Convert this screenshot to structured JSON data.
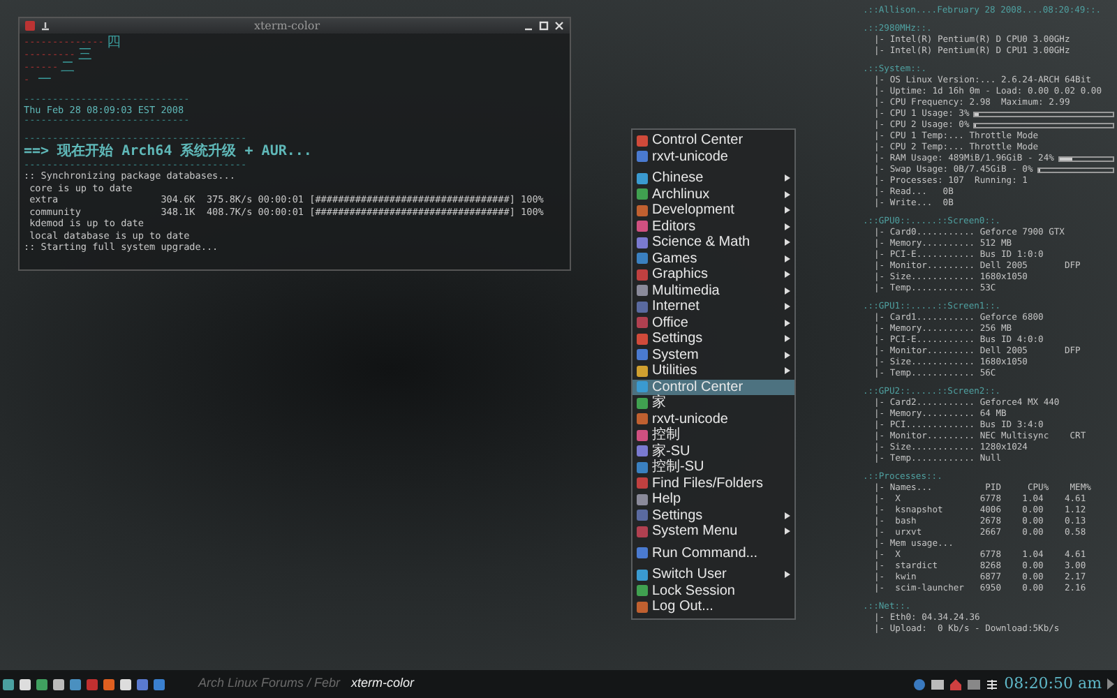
{
  "terminal": {
    "title": "xterm-color",
    "lines": [
      {
        "kind": "art",
        "text": "--------------",
        "glyph": "四"
      },
      {
        "kind": "art",
        "text": "---------",
        "glyph": "三"
      },
      {
        "kind": "art",
        "text": "------",
        "glyph": "二"
      },
      {
        "kind": "art",
        "text": "- ",
        "glyph": "一"
      },
      {
        "kind": "blank"
      },
      {
        "kind": "rule",
        "text": "-----------------------------"
      },
      {
        "kind": "date",
        "text": "Thu Feb 28 08:09:03 EST 2008"
      },
      {
        "kind": "rule",
        "text": "-----------------------------"
      },
      {
        "kind": "blank"
      },
      {
        "kind": "rule",
        "text": "---------------------------------------"
      },
      {
        "kind": "banner",
        "text": "==> 现在开始 Arch64 系统升级 + AUR..."
      },
      {
        "kind": "rule",
        "text": "---------------------------------------"
      },
      {
        "kind": "plain",
        "text": ":: Synchronizing package databases..."
      },
      {
        "kind": "plain",
        "text": " core is up to date"
      },
      {
        "kind": "plain",
        "text": " extra                  304.6K  375.8K/s 00:00:01 [##################################] 100%"
      },
      {
        "kind": "plain",
        "text": " community              348.1K  408.7K/s 00:00:01 [##################################] 100%"
      },
      {
        "kind": "plain",
        "text": " kdemod is up to date"
      },
      {
        "kind": "plain",
        "text": " local database is up to date"
      },
      {
        "kind": "plain",
        "text": ":: Starting full system upgrade..."
      }
    ]
  },
  "menu": {
    "items": [
      {
        "kind": "item",
        "label": "Control Center",
        "submenu": false,
        "selected": false
      },
      {
        "kind": "item",
        "label": "rxvt-unicode",
        "submenu": false,
        "selected": false
      },
      {
        "kind": "separator"
      },
      {
        "kind": "item",
        "label": "Chinese",
        "submenu": true,
        "selected": false
      },
      {
        "kind": "item",
        "label": "Archlinux",
        "submenu": true,
        "selected": false
      },
      {
        "kind": "item",
        "label": "Development",
        "submenu": true,
        "selected": false
      },
      {
        "kind": "item",
        "label": "Editors",
        "submenu": true,
        "selected": false
      },
      {
        "kind": "item",
        "label": "Science & Math",
        "submenu": true,
        "selected": false
      },
      {
        "kind": "item",
        "label": "Games",
        "submenu": true,
        "selected": false
      },
      {
        "kind": "item",
        "label": "Graphics",
        "submenu": true,
        "selected": false
      },
      {
        "kind": "item",
        "label": "Multimedia",
        "submenu": true,
        "selected": false
      },
      {
        "kind": "item",
        "label": "Internet",
        "submenu": true,
        "selected": false
      },
      {
        "kind": "item",
        "label": "Office",
        "submenu": true,
        "selected": false
      },
      {
        "kind": "item",
        "label": "Settings",
        "submenu": true,
        "selected": false
      },
      {
        "kind": "item",
        "label": "System",
        "submenu": true,
        "selected": false
      },
      {
        "kind": "item",
        "label": "Utilities",
        "submenu": true,
        "selected": false
      },
      {
        "kind": "item",
        "label": "Control Center",
        "submenu": false,
        "selected": true
      },
      {
        "kind": "item",
        "label": "家",
        "submenu": false,
        "selected": false
      },
      {
        "kind": "item",
        "label": "rxvt-unicode",
        "submenu": false,
        "selected": false
      },
      {
        "kind": "item",
        "label": "控制",
        "submenu": false,
        "selected": false
      },
      {
        "kind": "item",
        "label": "家-SU",
        "submenu": false,
        "selected": false
      },
      {
        "kind": "item",
        "label": "控制-SU",
        "submenu": false,
        "selected": false
      },
      {
        "kind": "item",
        "label": "Find Files/Folders",
        "submenu": false,
        "selected": false
      },
      {
        "kind": "item",
        "label": "Help",
        "submenu": false,
        "selected": false
      },
      {
        "kind": "item",
        "label": "Settings",
        "submenu": true,
        "selected": false
      },
      {
        "kind": "item",
        "label": "System Menu",
        "submenu": true,
        "selected": false
      },
      {
        "kind": "separator"
      },
      {
        "kind": "item",
        "label": "Run Command...",
        "submenu": false,
        "selected": false
      },
      {
        "kind": "separator"
      },
      {
        "kind": "item",
        "label": "Switch User",
        "submenu": true,
        "selected": false
      },
      {
        "kind": "item",
        "label": "Lock Session",
        "submenu": false,
        "selected": false
      },
      {
        "kind": "item",
        "label": "Log Out...",
        "submenu": false,
        "selected": false
      }
    ]
  },
  "conky": {
    "title": ".::Allison....February 28 2008....08:20:49::.",
    "sections": [
      {
        "header": ".::2980MHz::.",
        "rows": [
          {
            "text": "|- Intel(R) Pentium(R) D CPU0 3.00GHz"
          },
          {
            "text": "|- Intel(R) Pentium(R) D CPU1 3.00GHz"
          }
        ]
      },
      {
        "header": ".::System::.",
        "rows": [
          {
            "text": "|- OS Linux Version:... 2.6.24-ARCH 64Bit"
          },
          {
            "text": "|- Uptime: 1d 16h 0m - Load: 0.00 0.02 0.00"
          },
          {
            "text": "|- CPU Frequency: 2.98  Maximum: 2.99"
          },
          {
            "text": "|- CPU 1 Usage: 3%",
            "level": 0.03
          },
          {
            "text": "|- CPU 2 Usage: 0%",
            "level": 0
          },
          {
            "text": "|- CPU 1 Temp:... Throttle Mode"
          },
          {
            "text": "|- CPU 2 Temp:... Throttle Mode"
          },
          {
            "text": "|- RAM Usage: 489MiB/1.96GiB - 24%",
            "level": 0.24
          },
          {
            "text": "|- Swap Usage: 0B/7.45GiB - 0%",
            "level": 0
          },
          {
            "text": "|- Processes: 107  Running: 1"
          },
          {
            "text": "|- Read...   0B"
          },
          {
            "text": "|- Write...  0B"
          }
        ]
      },
      {
        "header": ".::GPU0::.....::Screen0::.",
        "rows": [
          {
            "text": "|- Card0........... Geforce 7900 GTX"
          },
          {
            "text": "|- Memory.......... 512 MB"
          },
          {
            "text": "|- PCI-E........... Bus ID 1:0:0"
          },
          {
            "text": "|- Monitor......... Dell 2005       DFP"
          },
          {
            "text": "|- Size............ 1680x1050"
          },
          {
            "text": "|- Temp............ 53C"
          }
        ]
      },
      {
        "header": ".::GPU1::.....::Screen1::.",
        "rows": [
          {
            "text": "|- Card1........... Geforce 6800"
          },
          {
            "text": "|- Memory.......... 256 MB"
          },
          {
            "text": "|- PCI-E........... Bus ID 4:0:0"
          },
          {
            "text": "|- Monitor......... Dell 2005       DFP"
          },
          {
            "text": "|- Size............ 1680x1050"
          },
          {
            "text": "|- Temp............ 56C"
          }
        ]
      },
      {
        "header": ".::GPU2::.....::Screen2::.",
        "rows": [
          {
            "text": "|- Card2........... Geforce4 MX 440"
          },
          {
            "text": "|- Memory.......... 64 MB"
          },
          {
            "text": "|- PCI............. Bus ID 3:4:0"
          },
          {
            "text": "|- Monitor......... NEC Multisync    CRT"
          },
          {
            "text": "|- Size............ 1280x1024"
          },
          {
            "text": "|- Temp............ Null"
          }
        ]
      },
      {
        "header": ".::Processes::.",
        "rows": [
          {
            "text": "|- Names...          PID     CPU%    MEM%"
          },
          {
            "text": "|-  X               6778    1.04    4.61"
          },
          {
            "text": "|-  ksnapshot       4006    0.00    1.12"
          },
          {
            "text": "|-  bash            2678    0.00    0.13"
          },
          {
            "text": "|-  urxvt           2667    0.00    0.58"
          },
          {
            "text": "|- Mem usage..."
          },
          {
            "text": "|-  X               6778    1.04    4.61"
          },
          {
            "text": "|-  stardict        8268    0.00    3.00"
          },
          {
            "text": "|-  kwin            6877    0.00    2.17"
          },
          {
            "text": "|-  scim-launcher   6950    0.00    2.16"
          }
        ]
      },
      {
        "header": ".::Net::.",
        "rows": [
          {
            "text": "|- Eth0: 04.34.24.36"
          },
          {
            "text": "|- Upload:  0 Kb/s - Download:5Kb/s"
          }
        ]
      }
    ]
  },
  "taskbar": {
    "tasks": [
      {
        "label": "Arch Linux Forums / Febr",
        "selected": false
      },
      {
        "label": "xterm-color",
        "selected": true
      }
    ],
    "clock": "08:20:50 am"
  }
}
